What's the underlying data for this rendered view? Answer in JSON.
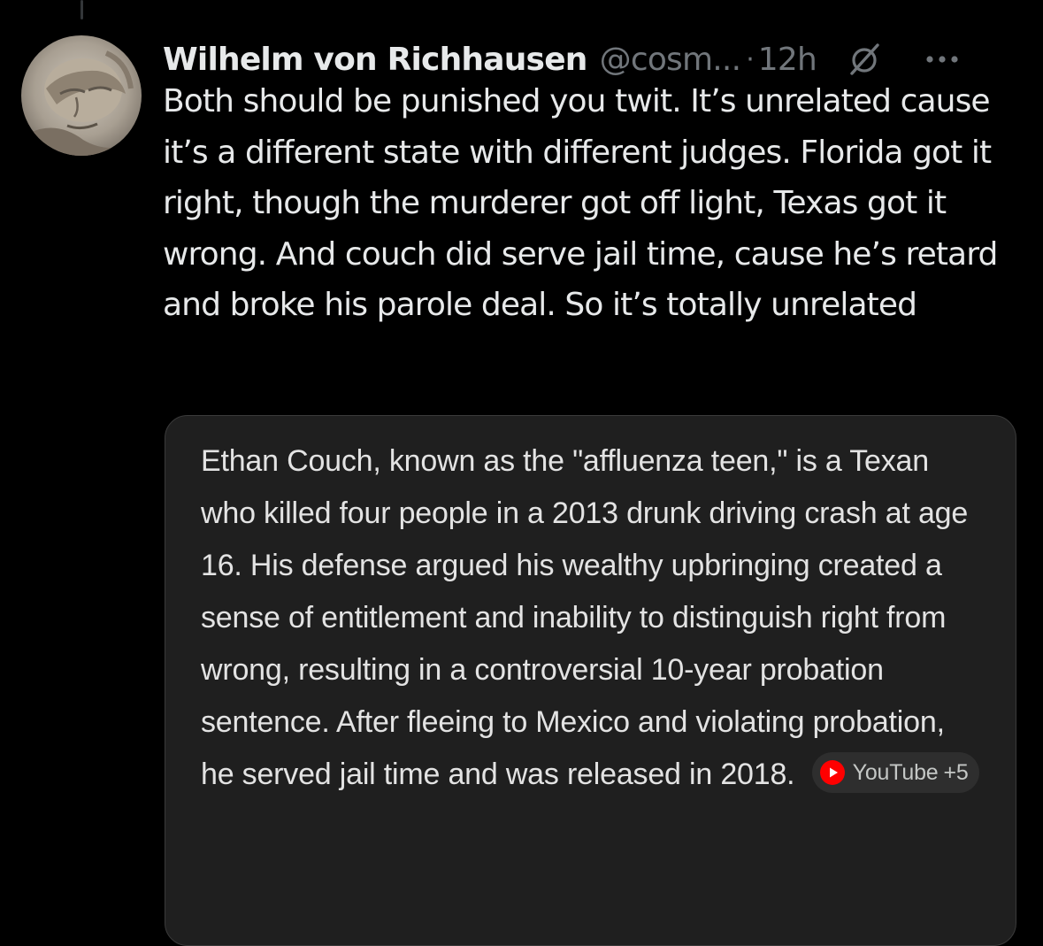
{
  "tweet": {
    "author_name": "Wilhelm von Richhausen",
    "handle": "@cosm...",
    "separator": "·",
    "time": "12h",
    "text": "Both should be punished you twit. It’s unrelated cause it’s a different state with different judges. Florida got it right, though the murderer got off light, Texas got it wrong. And couch did serve jail time, cause he’s retard and broke his parole deal. So it’s totally unrelated",
    "icons": {
      "avatar": "avatar-sculpture-face",
      "grok": "grok-slash-icon",
      "more": "more-dots-icon"
    }
  },
  "quote": {
    "text": "Ethan Couch, known as the \"affluenza teen,\" is a Texan who killed four people in a 2013 drunk driving crash at age 16. His defense argued his wealthy upbringing created a sense of entitlement and inability to distinguish right from wrong, resulting in a controversial 10-year probation sentence. After fleeing to Mexico and violating probation, he served jail time and was released in 2018.",
    "source": {
      "label": "YouTube",
      "more_count": "+5",
      "icon": "youtube-icon"
    }
  },
  "colors": {
    "background": "#000000",
    "primary_text": "#e7e9ea",
    "secondary_text": "#71767b",
    "card_background": "#1f1f1f",
    "youtube_red": "#ff0000"
  }
}
